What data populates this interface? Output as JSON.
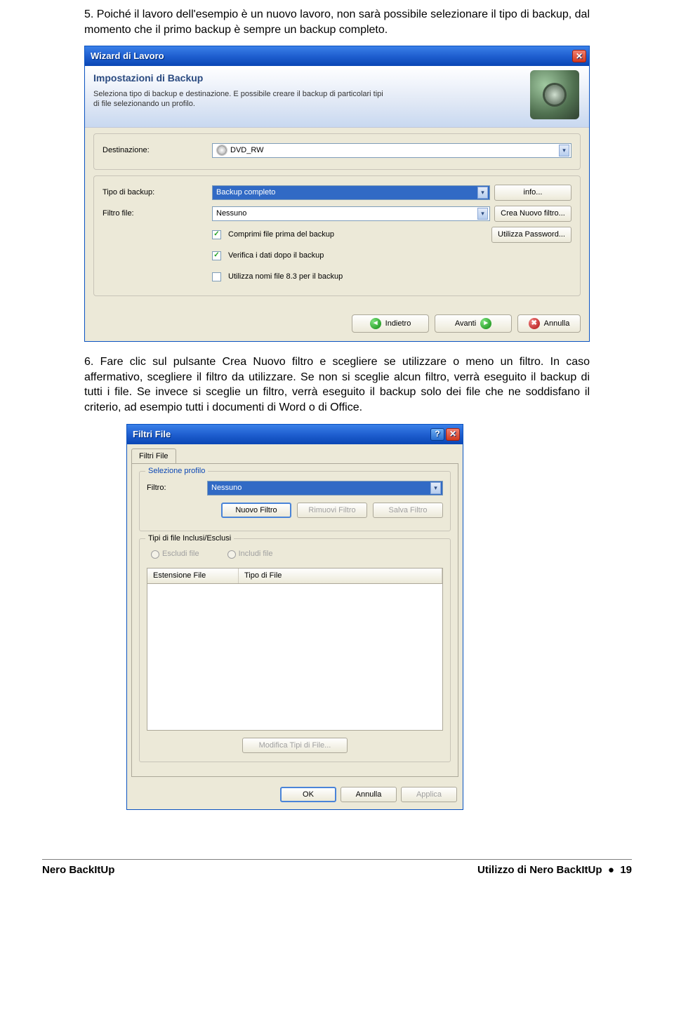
{
  "para5": "5. Poiché il lavoro dell'esempio è un nuovo lavoro, non sarà possibile selezionare il tipo di backup, dal momento che il primo backup è sempre un backup completo.",
  "para6": "6. Fare clic sul pulsante Crea Nuovo filtro e scegliere se utilizzare o meno un filtro. In caso affermativo, scegliere il filtro da utilizzare. Se non si sceglie alcun filtro, verrà eseguito il backup di tutti i file. Se invece si sceglie un filtro, verrà eseguito il backup solo dei file che ne soddisfano il criterio, ad esempio tutti i documenti di Word o di Office.",
  "wiz": {
    "title": "Wizard di Lavoro",
    "ribbon_title": "Impostazioni di Backup",
    "ribbon_sub": "Seleziona tipo di backup e destinazione. E possibile creare il backup di particolari tipi di file selezionando un profilo.",
    "dest_label": "Destinazione:",
    "dest_value": "DVD_RW",
    "type_label": "Tipo di backup:",
    "type_value": "Backup completo",
    "filter_label": "Filtro file:",
    "filter_value": "Nessuno",
    "btn_info": "info...",
    "btn_newfilter": "Crea Nuovo filtro...",
    "btn_password": "Utilizza Password...",
    "chk_compress": "Comprimi file prima del backup",
    "chk_verify": "Verifica i dati dopo il backup",
    "chk_83": "Utilizza nomi file 8.3 per il backup",
    "nav_back": "Indietro",
    "nav_next": "Avanti",
    "nav_cancel": "Annulla"
  },
  "dlg": {
    "title": "Filtri File",
    "tab": "Filtri File",
    "fs_profile": "Selezione profilo",
    "filter_label": "Filtro:",
    "filter_value": "Nessuno",
    "btn_new": "Nuovo Filtro",
    "btn_remove": "Rimuovi Filtro",
    "btn_save": "Salva Filtro",
    "fs_types": "Tipi di file Inclusi/Esclusi",
    "radio_excl": "Escludi file",
    "radio_incl": "Includi file",
    "col_ext": "Estensione File",
    "col_type": "Tipo di File",
    "btn_modify": "Modifica Tipi di File...",
    "btn_ok": "OK",
    "btn_cancel": "Annulla",
    "btn_apply": "Applica"
  },
  "footer": {
    "left": "Nero BackItUp",
    "right_prefix": "Utilizzo di Nero BackItUp",
    "dot": "●",
    "page": "19"
  }
}
